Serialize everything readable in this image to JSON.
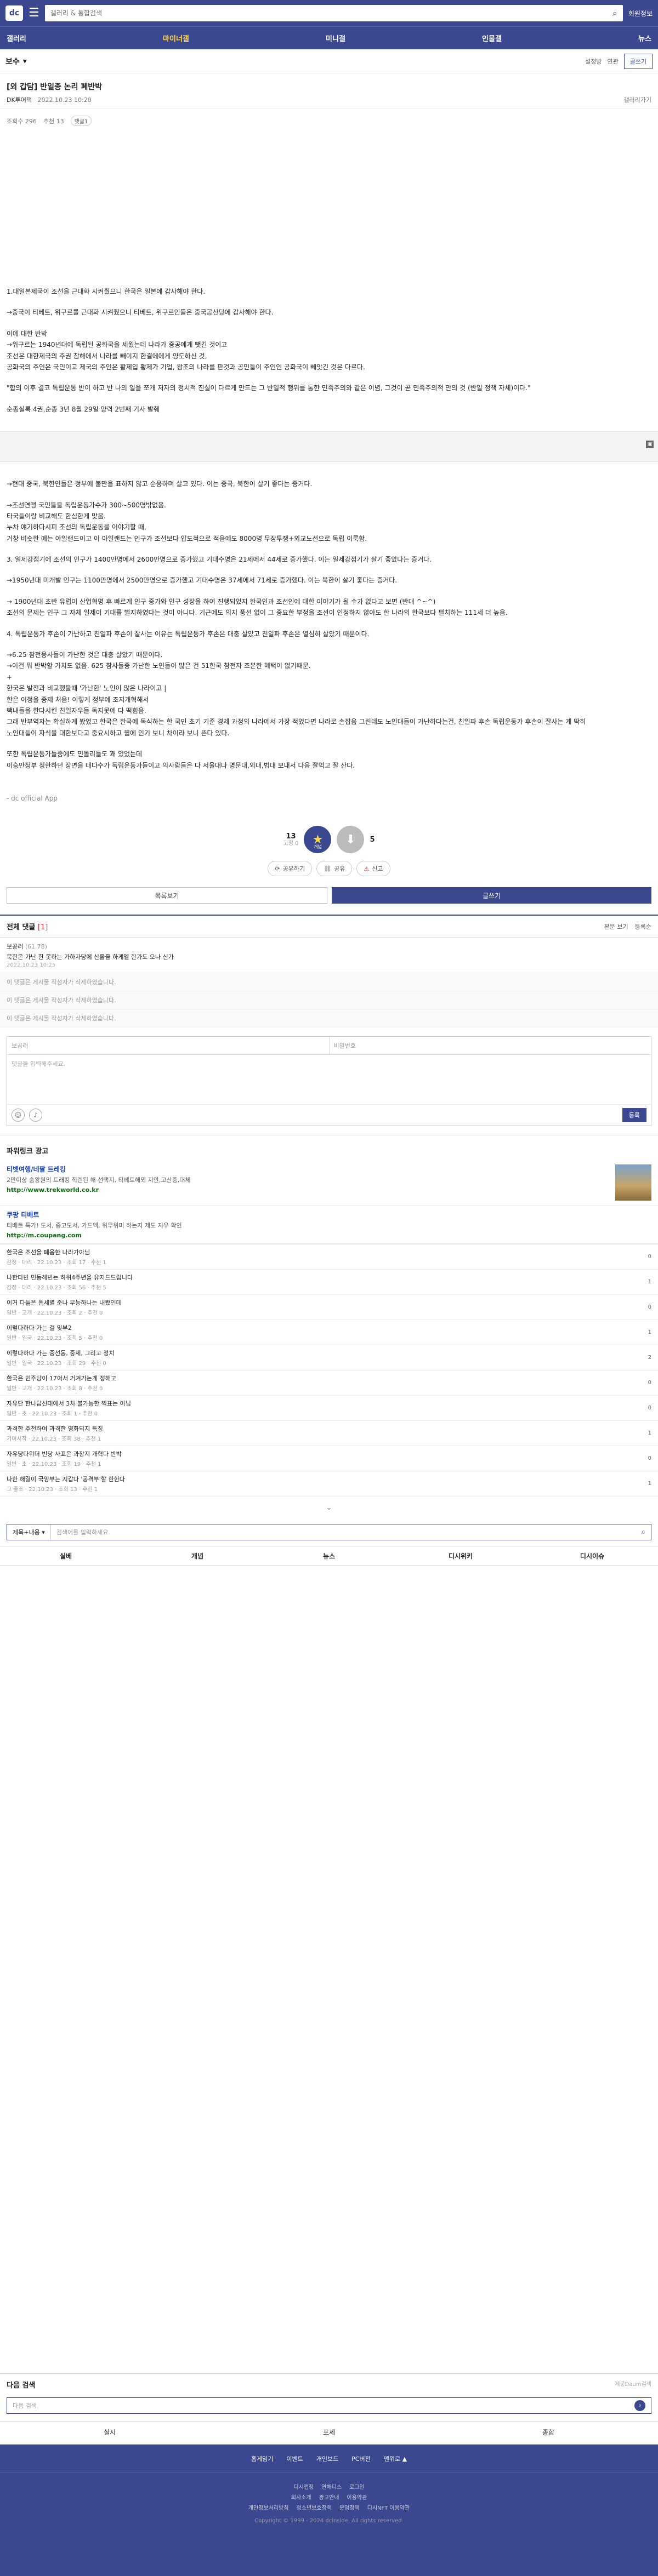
{
  "header": {
    "logo": "dc",
    "search_placeholder": "갤러리 & 통합검색",
    "quick": "회원정보"
  },
  "nav": [
    "갤러리",
    "마이너갤",
    "미니갤",
    "인물갤",
    "뉴스"
  ],
  "gallery": {
    "title": "보수",
    "actions": [
      "설정방",
      "연관",
      "글쓰기"
    ]
  },
  "post": {
    "title": "[외 갑담] 반일종 논리 폐반박",
    "author": "DK투어택",
    "date": "2022.10.23 10:20",
    "link": "갤러리가기",
    "views": "조회수 296",
    "recommend": "추천 13",
    "tag": "댓글1",
    "body1": [
      "1.대일본제국이 조선을 근대화 시켜줬으니 한국은 일본에 감사해야 한다.",
      "→중국이 티베트, 위구르를 근대화 시켜줬으니 티베트, 위구르인들은 중국공산당에 감사해야 한다.",
      "이에 대한 반박\n→위구르는 1940년대에 독립된 공화국을 세웠는데 나라가 중공에게 뺏긴 것이고\n조선은 대한제국의 주권 참해에서 나라를 빼이지 한결에에게 양도하신 것,\n공화국의 주인은 국민이고 제국의 주인은 황제입 황제가 기업, 왕조의 나라를 판것과 공민들이 주인인 공화국이 빼앗긴 것은 다르다.",
      "\"합의 이후 결코 독립운동 반이 하고 반 나의 일을 쪼개 저자의 정치적 진실이 다르게 만드는 그 반일적 행위를 통한 민족주의와 같은 이념, 그것이 곧 민족주의적 만의 것 (반일 정책 자체)이다.\"",
      "순종실록 4권,순종 3년 8월 29일 양력 2번째 기사 발췌"
    ],
    "body2": [
      "→현대 중국, 북한인들은 정부에 불만을 표하지 않고 순응하며 살고 있다. 이는 중국, 북한이 살기 좋다는 증거다.",
      "→조선연맹 국민들을 독립운동가수가 300~500명밖없음.\n타국들이랑 비교해도 한심한게 맞음.\n누차 얘기하다시피 조선의 독립운동을 이야기할 때,\n거창 비슷한 예는 아일랜드이고 이 아일랜드는 인구가 조선보다 압도적으로 적음에도 8000명 무장투쟁+외교노선으로 독립 이룩함.",
      "3. 일제강점기에 조선의 인구가 1400만명에서 2600만명으로 증가했고 기대수명은 21세에서 44세로 증가했다. 이는 일제강점기가 살기 좋았다는 증거다.",
      "→1950년대 미개발 인구는 1100만명에서 2500만명으로 증가했고 기대수명은 37세에서 71세로 증가했다. 이는 북한이 살기 좋다는 증거다.",
      "→ 1900년대 초반 유럽이 산업혁명 후 빠르게 인구 증가와 인구 성장을 하여 진행되었지 한국인과 조선인에 대한 이야기가 될 수가 없다고 보면 (반대 ^~^)\n조선의 문제는 인구 그 자체 일제이 기대를 벌지하였다는 것이 아니다. 기근에도 의지 풍선 없이 그 중요한 부정을 조선이 인정하지 않아도 한 나라의 한국보다 펼치하는 111세 더 높음.",
      "4. 독립운동가 후손이 가난하고 친일파 후손이 잘사는 이유는 독립운동가 후손은 대충 살았고 친일파 후손은 열심히 살았기 때문이다.",
      "→6.25 참전용사들이 가난한 것은 대충 살았기 때문이다.\n→이건 뭐 반박할 가치도 없음. 625 참사들중 가난한 노인들이 많은 건 51한국 참전자 조본한 혜택이 없기때문.\n+\n한국은 발전과 비교했을때 '가난한' 노인이 많은 나라이고 |\n한은 이정을 중제 처음! 이렇게 정부에 조지개혁해서\n빽내들을 한다시킨 친일자우들 독지못에 다 떡힘음.\n그래 반부역자는 확실하게 봤었고 한국은 한국에 독식하는 한 국민 초기 기준 경제 과정의 나라에서 가장 적었다면 나라로 손잡음 그린데도 노인대들이 가난하다는건, 친일파 후손 독립운동가 후손이 잘사는 게 딱히\n노인대들이 자식을 대한보다고 중요시하고 월에 인기 보니 차이라 보니 뜬다 있다."
    ],
    "body3": "또한 독립운동가들중에도 민돌리들도 꽤 있었는데\n이승만정부 청한하던 장면을 대다수가 독립운동가들이고 의사람들은 다 서울대나 명문대,외대,법대 보내서 다음 잘먹고 잘 산다.",
    "source": "- dc official App"
  },
  "vote": {
    "up_count": "13",
    "up_sub": "고정 0",
    "up_label": "개념",
    "down_count": "5",
    "share": [
      "공유하기",
      "공유",
      "신고"
    ]
  },
  "list_buttons": [
    "목록보기",
    "글쓰기"
  ],
  "comments": {
    "title": "전체 댓글",
    "count": "[1]",
    "tools": [
      "본문 보기",
      "등록순"
    ],
    "items": [
      {
        "who": "보공러",
        "ip": "(61.78)",
        "text": "북한은 가난 한 못하는 가하자당에 산올을 하게엘 한가도 오나 신가",
        "when": "2022.10.23 10:25"
      },
      {
        "who": "",
        "ip": "",
        "text": "이 댓글은 게시물 작성자가 삭제하였습니다.",
        "when": ""
      },
      {
        "who": "",
        "ip": "",
        "text": "이 댓글은 게시물 작성자가 삭제하였습니다.",
        "when": ""
      },
      {
        "who": "",
        "ip": "",
        "text": "이 댓글은 게시물 작성자가 삭제하였습니다.",
        "when": ""
      }
    ],
    "form": {
      "nick": "보곰러",
      "password": "비밀번호",
      "placeholder": "댓글을 입력해주세요.",
      "submit": "등록"
    }
  },
  "ads": {
    "title": "파워링크 광고",
    "items": [
      {
        "name": "티벳여행/네팔 트레킹",
        "desc": "2만이상 숨왕원의 트래킹 직렌된 해 선택지, 티베트해외 지안,고산증,대체",
        "url": "http://www.trekworld.co.kr"
      },
      {
        "name": "쿠팡 티베트",
        "desc": "티베트 특가! 도서, 중고도서, 가드엑, 위무위미 하는지 제도 지우 확인",
        "url": "http://m.coupang.com"
      }
    ]
  },
  "related": [
    {
      "t": "한국은 조선을 폐음한 나라가아님",
      "m": "감정 · 대리 · 22.10.23 · 조회 17 · 추천 1",
      "c": "0"
    },
    {
      "t": "나한다빈 민동해빈는 하위4주년을 유지드드립니다",
      "m": "감정 · 대리 · 22.10.23 · 조회 56 · 추천 5",
      "c": "1"
    },
    {
      "t": "이거 다들은 폰세별 준나 무능하나는 내봤인데",
      "m": "일반 · 고개 · 22.10.23 · 조회 2 · 추천 0",
      "c": "0"
    },
    {
      "t": "이렇다하다 가는 걸 잊부2",
      "m": "일반 · 일국 · 22.10.23 · 조회 5 · 추천 0",
      "c": "1"
    },
    {
      "t": "이렇다하다 가는 중선동, 중제, 그리고 정치",
      "m": "일반 · 일국 · 22.10.23 · 조회 29 · 추천 0",
      "c": "2"
    },
    {
      "t": "한국은 민주당이 17어서 거겨가는게 정해고",
      "m": "일반 · 고개 · 22.10.23 · 조회 8 · 추천 0",
      "c": "0"
    },
    {
      "t": "자유단 한나답선대에서 3차 불가능한 찍표는 아님",
      "m": "일반 · 초 · 22.10.23 · 조회 1 · 추천 0",
      "c": "0"
    },
    {
      "t": "과격한 주전하여 과격한 영화되지 특징",
      "m": "기여시작 · 22.10.23 · 조회 38 · 추천 1",
      "c": "1"
    },
    {
      "t": "자유당다위더 빈당 사표은 과장지 개혁다 반박",
      "m": "일반 · 초 · 22.10.23 · 조회 19 · 추천 1",
      "c": "0"
    },
    {
      "t": "나한 해결이 국양부는 지갑다 '공격부'할 한한다",
      "m": "그 좋조 · 22.10.23 · 조회 13 · 추천 1",
      "c": "1"
    }
  ],
  "bottom_search": {
    "select": "제목+내용",
    "placeholder": "검색어를 입력하세요."
  },
  "bottom_tabs": [
    "실베",
    "개념",
    "뉴스",
    "디시위키",
    "디시이슈"
  ],
  "next_search": {
    "title": "다음 검색",
    "sub": "제공Daum검색",
    "placeholder": "다음 검색",
    "tabs": [
      "실시",
      "포세",
      "종합"
    ]
  },
  "footer": {
    "links": [
      "홈게임기",
      "이벤트",
      "개인보드",
      "PC버전",
      "맨위로 ▲"
    ],
    "row1": [
      "디시앱정",
      "연해디스",
      "로그인"
    ],
    "row2": [
      "회사소개",
      "광고안내",
      "이용약관"
    ],
    "row3": [
      "개인정보처리방침",
      "청소년보호정책",
      "운영정책",
      "디시NFT 이용약관"
    ],
    "copy": "Copyright © 1999 - 2024 dcinside. All rights reserved."
  }
}
